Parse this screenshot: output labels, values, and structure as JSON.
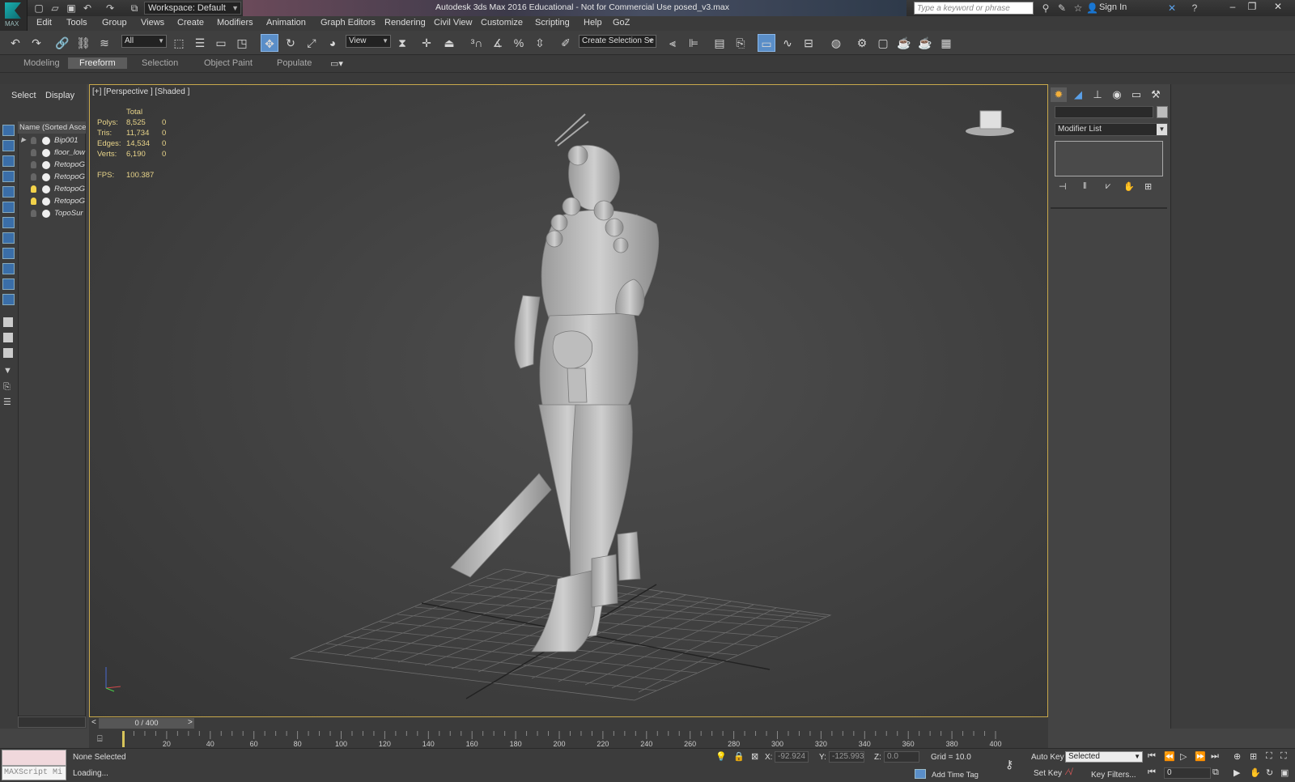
{
  "app": {
    "title": "Autodesk 3ds Max 2016 Educational - Not for Commercial Use    posed_v3.max",
    "logo_label": "MAX",
    "workspace": "Workspace: Default",
    "search_placeholder": "Type a keyword or phrase",
    "sign_in": "Sign In"
  },
  "menu": [
    "Edit",
    "Tools",
    "Group",
    "Views",
    "Create",
    "Modifiers",
    "Animation",
    "Graph Editors",
    "Rendering",
    "Civil View",
    "Customize",
    "Scripting",
    "Help",
    "GoZ"
  ],
  "toolbar": {
    "filter_value": "All",
    "coord_value": "View",
    "selection_set_placeholder": "Create Selection Se"
  },
  "ribbon": {
    "tabs": [
      "Modeling",
      "Freeform",
      "Selection",
      "Object Paint",
      "Populate"
    ],
    "active_tab": "Freeform"
  },
  "explorer": {
    "tabs": [
      "Select",
      "Display"
    ],
    "header": "Name (Sorted Ascen",
    "rows": [
      {
        "name": "Bip001",
        "lit": false,
        "expandable": true
      },
      {
        "name": "floor_low",
        "lit": false,
        "expandable": false
      },
      {
        "name": "RetopoG",
        "lit": false,
        "expandable": false
      },
      {
        "name": "RetopoG",
        "lit": false,
        "expandable": false
      },
      {
        "name": "RetopoG",
        "lit": true,
        "expandable": false
      },
      {
        "name": "RetopoG",
        "lit": true,
        "expandable": false
      },
      {
        "name": "TopoSur",
        "lit": false,
        "expandable": false
      }
    ]
  },
  "viewport": {
    "label": "[+] [Perspective ] [Shaded ]",
    "stats": {
      "header": "Total",
      "rows": [
        {
          "label": "Polys:",
          "total": "8,525",
          "sel": "0"
        },
        {
          "label": "Tris:",
          "total": "11,734",
          "sel": "0"
        },
        {
          "label": "Edges:",
          "total": "14,534",
          "sel": "0"
        },
        {
          "label": "Verts:",
          "total": "6,190",
          "sel": "0"
        }
      ],
      "fps_label": "FPS:",
      "fps_value": "100.387"
    },
    "accent": "#c8a84b"
  },
  "command_panel": {
    "modifier_list": "Modifier List"
  },
  "timeline": {
    "frame_counter": "0 / 400",
    "prev": "<",
    "next": ">",
    "ticks": [
      20,
      40,
      60,
      80,
      100,
      120,
      140,
      160,
      180,
      200,
      220,
      240,
      260,
      280,
      300,
      320,
      340,
      360,
      380,
      400
    ]
  },
  "status": {
    "maxscript": "MAXScript Mi",
    "selection": "None Selected",
    "prompt": "Loading...",
    "x_label": "X:",
    "x_value": "-92.924",
    "y_label": "Y:",
    "y_value": "-125.993",
    "z_label": "Z:",
    "z_value": "0.0",
    "grid": "Grid = 10.0",
    "add_time_tag": "Add Time Tag",
    "auto_key": "Auto Key",
    "set_key": "Set Key",
    "selected_value": "Selected",
    "key_filters": "Key Filters...",
    "frame_value": "0"
  }
}
